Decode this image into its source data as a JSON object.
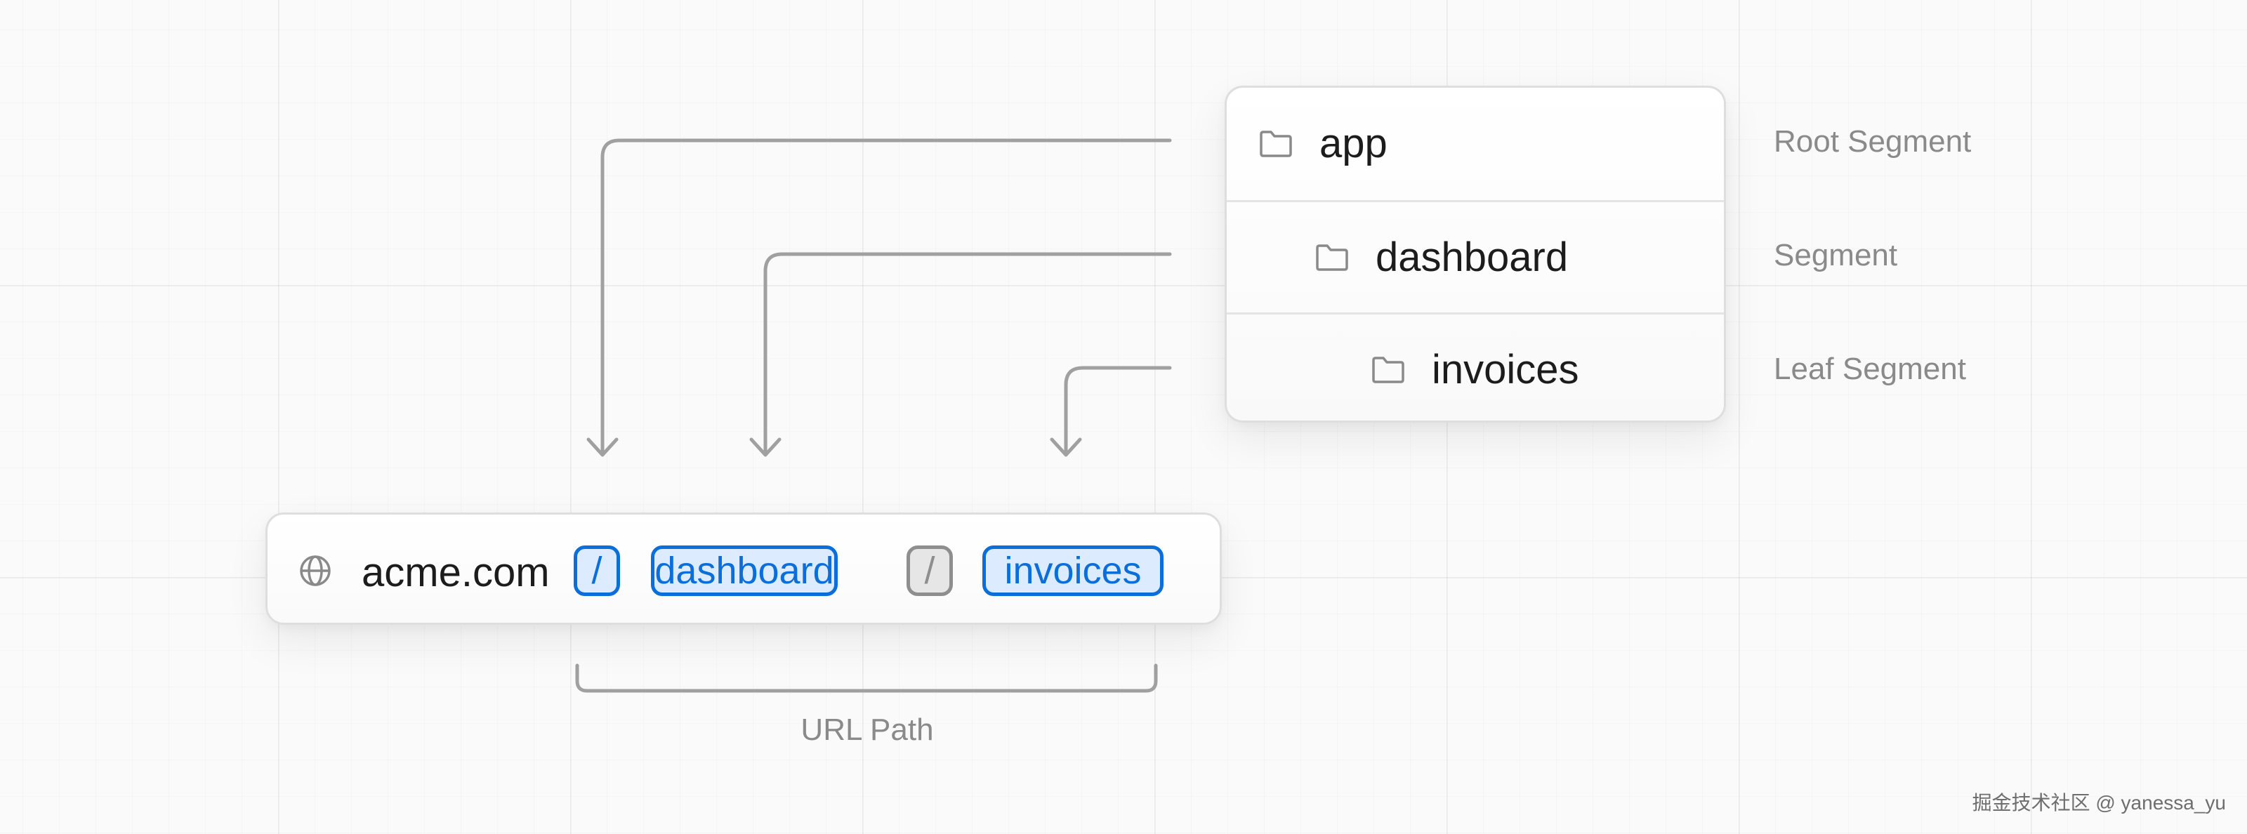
{
  "tree": {
    "root_folder": "app",
    "segment_folder": "dashboard",
    "leaf_folder": "invoices"
  },
  "labels": {
    "root_segment": "Root Segment",
    "segment": "Segment",
    "leaf_segment": "Leaf Segment"
  },
  "url": {
    "domain": "acme.com",
    "parts": [
      "/",
      "dashboard",
      "/",
      "invoices"
    ],
    "path_label": "URL Path"
  },
  "icons": {
    "folder": "folder-icon",
    "globe": "globe-icon",
    "arrow": "arrow-down-icon"
  },
  "colors": {
    "accent_blue": "#0a6edb",
    "chip_blue_fill": "#dcebfd",
    "chip_gray": "#8e8e8e",
    "connector": "#a0a0a0",
    "label_gray": "#8a8a8a"
  },
  "watermark": "掘金技术社区 @ yanessa_yu"
}
